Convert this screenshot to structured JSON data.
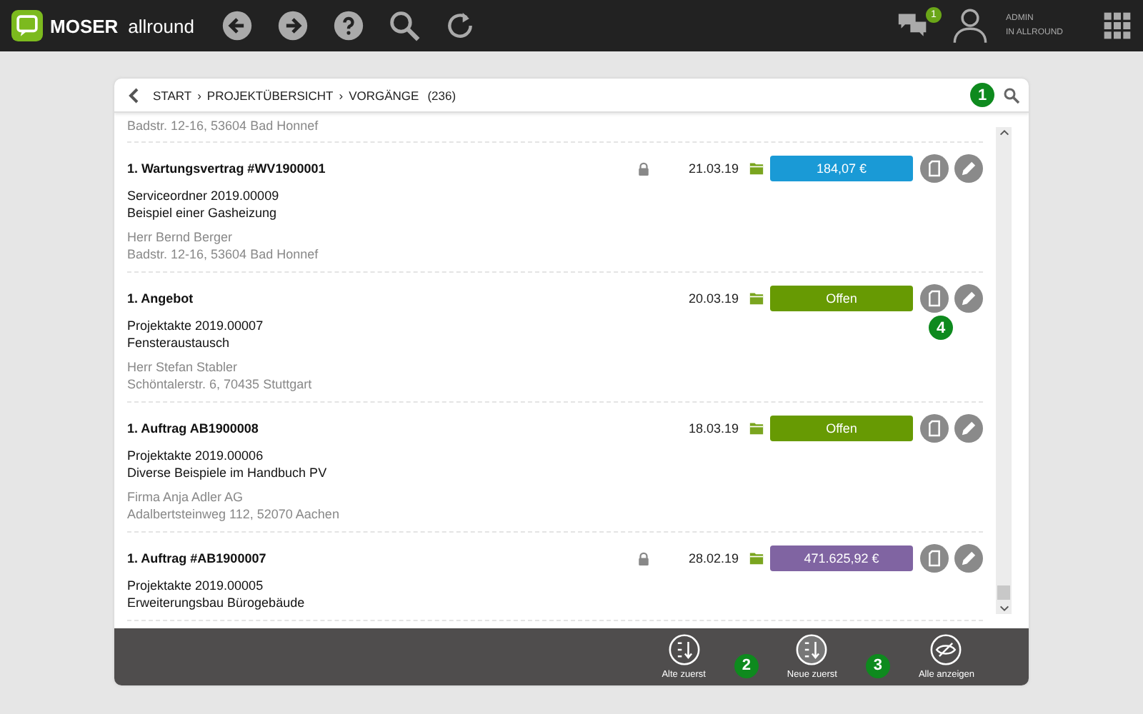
{
  "topbar": {
    "logo": {
      "brand": "MOSER",
      "product": "allround"
    },
    "messages_badge": "1",
    "user": {
      "line1": "ADMIN",
      "line2": "IN ALLROUND"
    }
  },
  "header": {
    "breadcrumb": [
      "START",
      "PROJEKTÜBERSICHT",
      "VORGÄNGE"
    ],
    "separator": "›",
    "count": "(236)",
    "marker": "1"
  },
  "partial_item": {
    "contact": [
      "Badstr. 12-16, 53604 Bad Honnef"
    ]
  },
  "items": [
    {
      "title": "1. Wartungsvertrag #WV1900001",
      "locked": true,
      "date": "21.03.19",
      "status": "184,07 €",
      "color": "#1a9ad6",
      "lines": [
        "Serviceordner 2019.00009",
        "Beispiel einer Gasheizung"
      ],
      "contact": [
        "Herr Bernd Berger",
        "Badstr. 12-16, 53604 Bad Honnef"
      ]
    },
    {
      "title": "1. Angebot",
      "locked": false,
      "date": "20.03.19",
      "status": "Offen",
      "color": "#679a03",
      "lines": [
        "Projektakte 2019.00007",
        "Fensteraustausch"
      ],
      "contact": [
        "Herr Stefan Stabler",
        "Schöntalerstr. 6, 70435 Stuttgart"
      ],
      "marker": "4"
    },
    {
      "title": "1. Auftrag AB1900008",
      "locked": false,
      "date": "18.03.19",
      "status": "Offen",
      "color": "#679a03",
      "lines": [
        "Projektakte 2019.00006",
        "Diverse Beispiele im Handbuch PV"
      ],
      "contact": [
        "Firma Anja Adler AG",
        "Adalbertsteinweg 112, 52070 Aachen"
      ]
    },
    {
      "title": "1. Auftrag #AB1900007",
      "locked": true,
      "date": "28.02.19",
      "status": "471.625,92 €",
      "color": "#8064a2",
      "lines": [
        "Projektakte 2019.00005",
        "Erweiterungsbau Bürogebäude"
      ]
    }
  ],
  "footer": [
    {
      "kind": "button",
      "label": "Alte zuerst"
    },
    {
      "kind": "marker",
      "label": "2"
    },
    {
      "kind": "button",
      "label": "Neue zuerst"
    },
    {
      "kind": "marker",
      "label": "3"
    },
    {
      "kind": "button",
      "label": "Alle anzeigen"
    }
  ]
}
